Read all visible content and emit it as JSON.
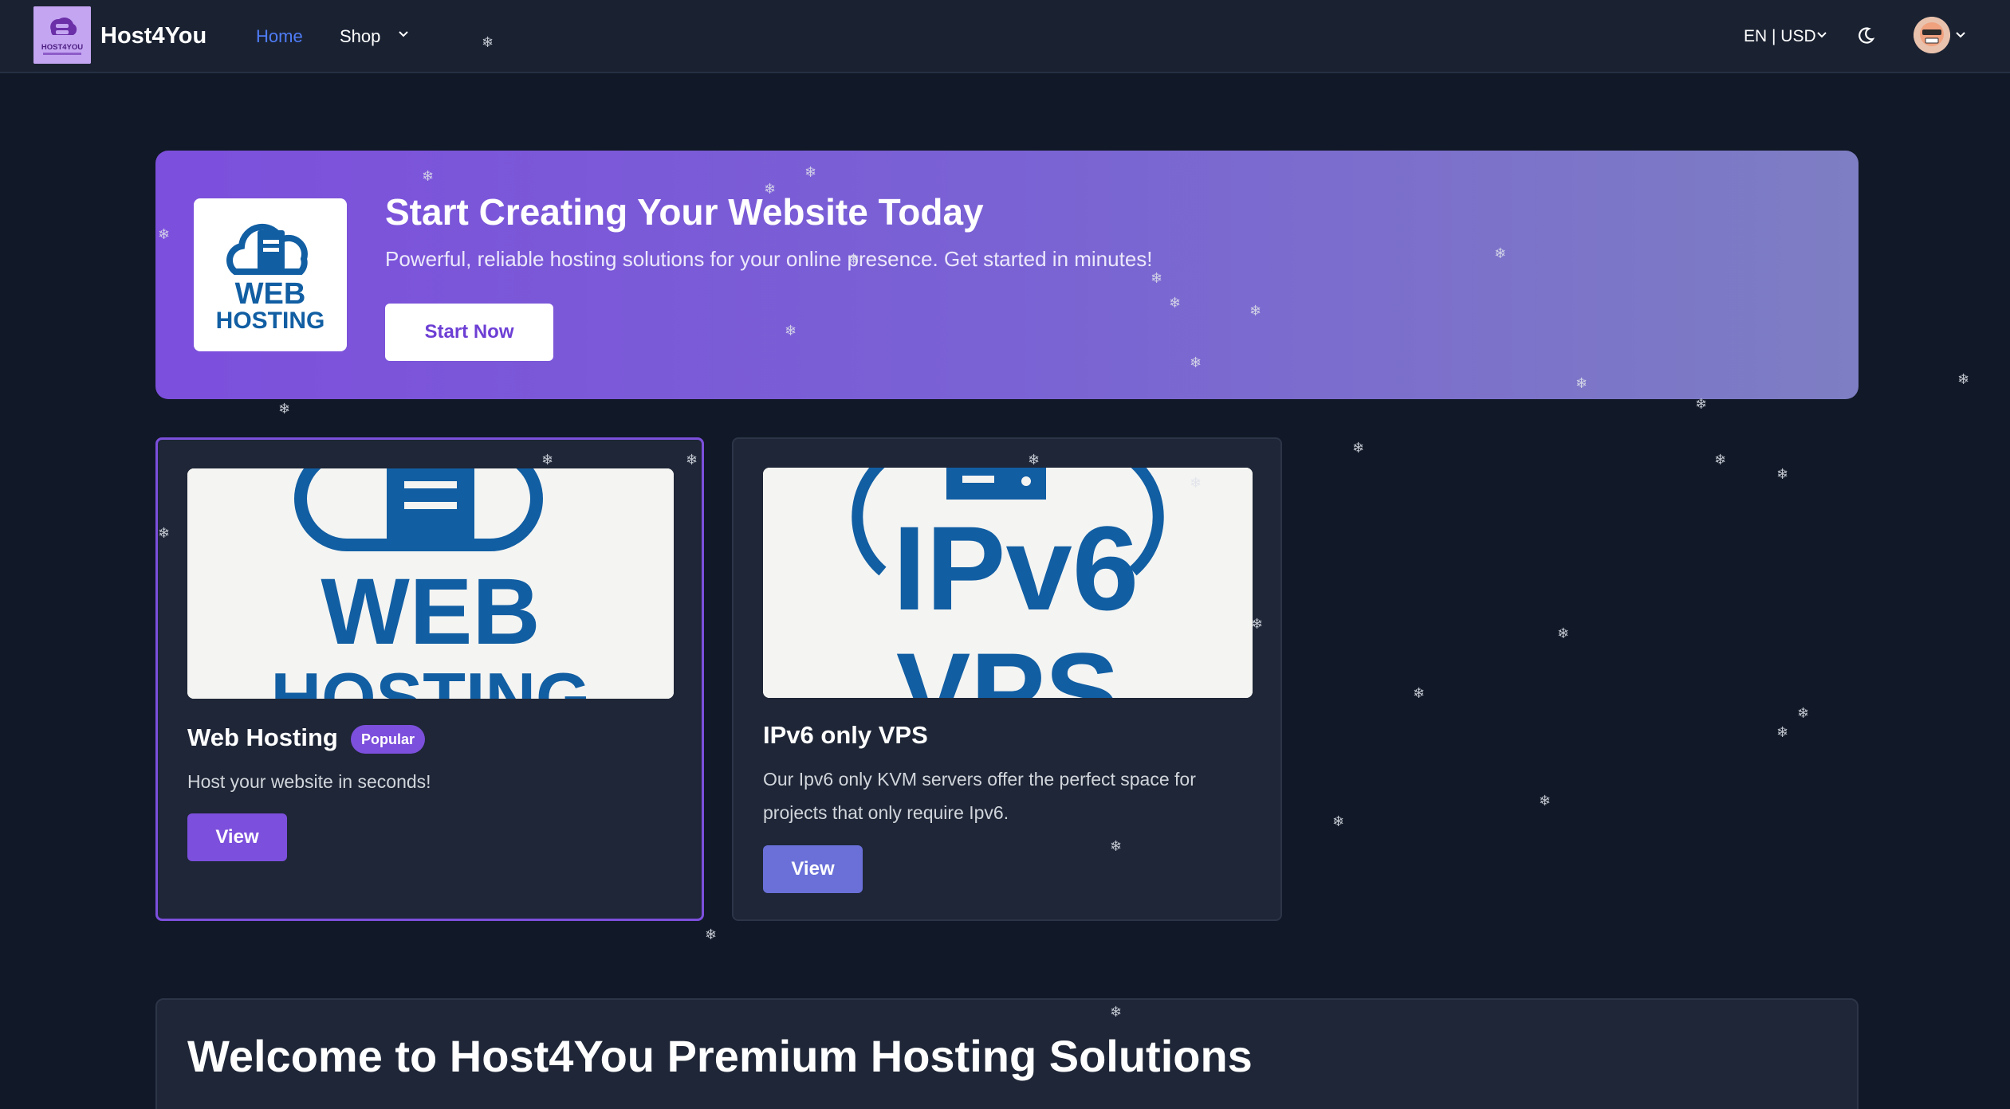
{
  "nav": {
    "brand": "Host4You",
    "logo_text": "HOST4YOU",
    "home": "Home",
    "shop": "Shop",
    "lang_currency": "EN | USD"
  },
  "hero": {
    "logo_line1": "WEB",
    "logo_line2": "HOSTING",
    "title": "Start Creating Your Website Today",
    "subtitle": "Powerful, reliable hosting solutions for your online presence. Get started in minutes!",
    "cta": "Start Now"
  },
  "products": [
    {
      "image_line1": "WEB",
      "image_line2": "HOSTING",
      "title": "Web Hosting",
      "badge": "Popular",
      "description": "Host your website in seconds!",
      "button": "View"
    },
    {
      "image_line1": "IPv6",
      "image_line2": "VPS",
      "title": "IPv6 only VPS",
      "description": "Our Ipv6 only KVM servers offer the perfect space for projects that only require Ipv6.",
      "button": "View"
    }
  ],
  "welcome": {
    "title": "Welcome to Host4You Premium Hosting Solutions"
  },
  "colors": {
    "accent": "#7c4fdc",
    "nav_active": "#4f7cf7",
    "background": "#111827",
    "card": "#1e2637"
  },
  "icons": {
    "shop_dropdown": "chevron-down-icon",
    "theme_toggle": "moon-icon",
    "decoration": "snowflake-icon"
  }
}
